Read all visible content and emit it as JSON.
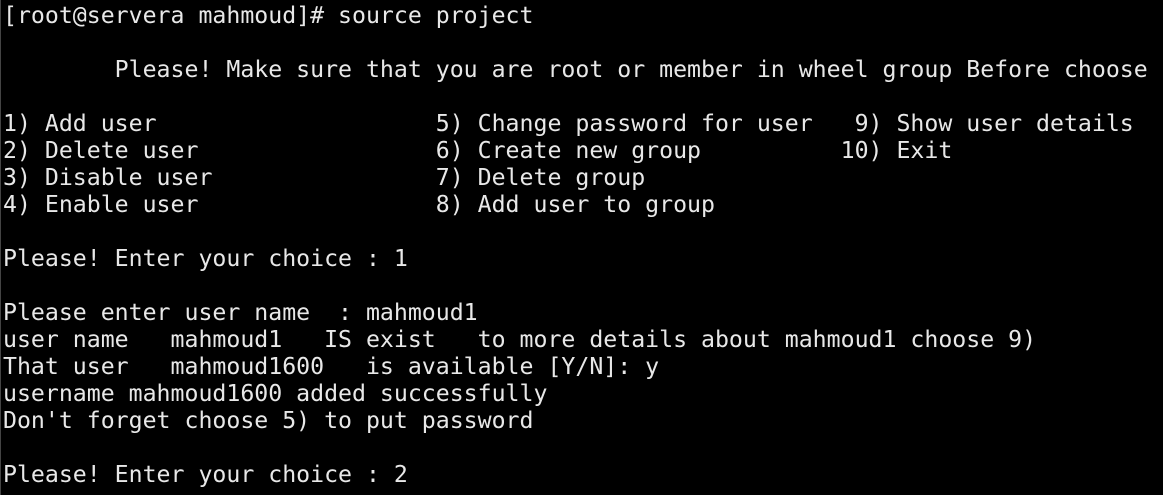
{
  "terminal": {
    "lines": [
      "[root@servera mahmoud]# source project",
      "",
      "        Please! Make sure that you are root or member in wheel group Before choose",
      "",
      "1) Add user                    5) Change password for user   9) Show user details",
      "2) Delete user                 6) Create new group          10) Exit",
      "3) Disable user                7) Delete group",
      "4) Enable user                 8) Add user to group",
      "",
      "Please! Enter your choice : 1",
      "",
      "Please enter user name  : mahmoud1",
      "user name   mahmoud1   IS exist   to more details about mahmoud1 choose 9)",
      "That user   mahmoud1600   is available [Y/N]: y",
      "username mahmoud1600 added successfully",
      "Don't forget choose 5) to put password",
      "",
      "Please! Enter your choice : 2"
    ]
  },
  "colors": {
    "background": "#000000",
    "foreground": "#e8e8e8"
  }
}
